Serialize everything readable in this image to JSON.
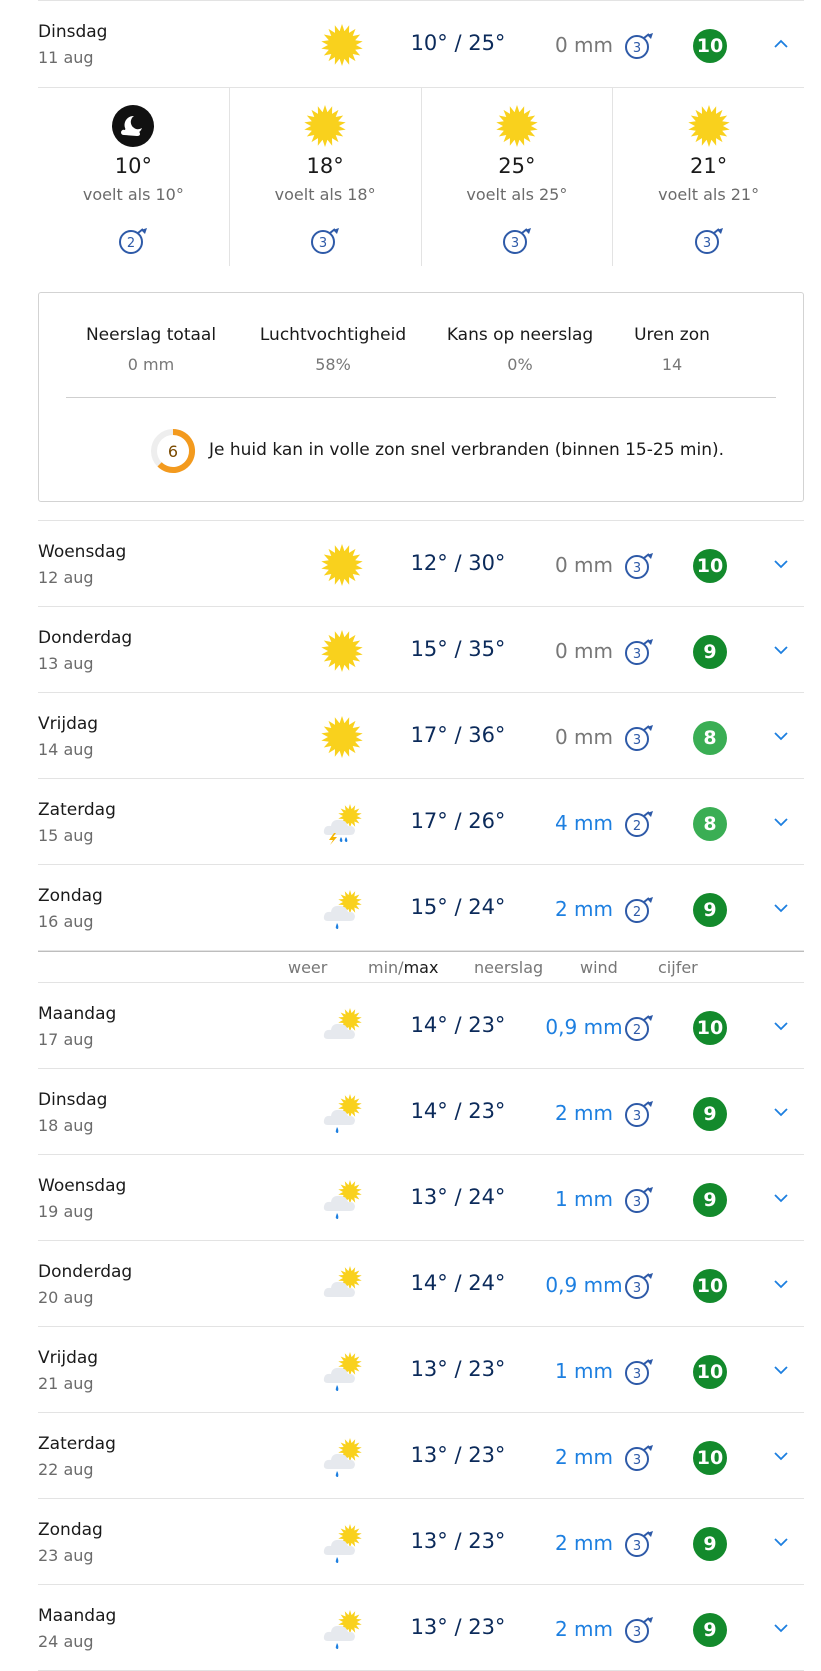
{
  "expanded_day": {
    "name": "Dinsdag",
    "date": "11 aug",
    "icon": "sun-icon",
    "temps": "10° / 25°",
    "precip": "0 mm",
    "wind": "3",
    "score": "10",
    "parts": [
      {
        "icon": "moon-cloud-icon",
        "temp": "10°",
        "feels": "voelt als 10°",
        "wind": "2"
      },
      {
        "icon": "sun-icon",
        "temp": "18°",
        "feels": "voelt als 18°",
        "wind": "3"
      },
      {
        "icon": "sun-icon",
        "temp": "25°",
        "feels": "voelt als 25°",
        "wind": "3"
      },
      {
        "icon": "sun-icon",
        "temp": "21°",
        "feels": "voelt als 21°",
        "wind": "3"
      }
    ],
    "stats": [
      {
        "label": "Neerslag totaal",
        "value": "0 mm"
      },
      {
        "label": "Luchtvochtigheid",
        "value": "58%"
      },
      {
        "label": "Kans op neerslag",
        "value": "0%"
      },
      {
        "label": "Uren zon",
        "value": "14"
      }
    ],
    "uv_index": "6",
    "uv_text": "Je huid kan in volle zon snel verbranden (binnen 15-25 min)."
  },
  "days_a": [
    {
      "name": "Woensdag",
      "date": "12 aug",
      "icon": "sun-icon",
      "temps": "12° / 30°",
      "precip": "0 mm",
      "wind": "3",
      "score": "10"
    },
    {
      "name": "Donderdag",
      "date": "13 aug",
      "icon": "sun-icon",
      "temps": "15° / 35°",
      "precip": "0 mm",
      "wind": "3",
      "score": "9"
    },
    {
      "name": "Vrijdag",
      "date": "14 aug",
      "icon": "sun-icon",
      "temps": "17° / 36°",
      "precip": "0 mm",
      "wind": "3",
      "score": "8"
    },
    {
      "name": "Zaterdag",
      "date": "15 aug",
      "icon": "thunder-rain-sun-icon",
      "temps": "17° / 26°",
      "precip": "4 mm",
      "wind": "2",
      "score": "8"
    },
    {
      "name": "Zondag",
      "date": "16 aug",
      "icon": "rain-sun-cloud-icon",
      "temps": "15° / 24°",
      "precip": "2 mm",
      "wind": "2",
      "score": "9"
    }
  ],
  "legend": {
    "weer": "weer",
    "min": "min/",
    "max": "max",
    "neerslag": "neerslag",
    "wind": "wind",
    "cijfer": "cijfer"
  },
  "days_b": [
    {
      "name": "Maandag",
      "date": "17 aug",
      "icon": "sun-cloud-icon",
      "temps": "14° / 23°",
      "precip": "0,9 mm",
      "wind": "2",
      "score": "10"
    },
    {
      "name": "Dinsdag",
      "date": "18 aug",
      "icon": "rain-sun-cloud-icon",
      "temps": "14° / 23°",
      "precip": "2 mm",
      "wind": "3",
      "score": "9"
    },
    {
      "name": "Woensdag",
      "date": "19 aug",
      "icon": "rain-sun-cloud-icon",
      "temps": "13° / 24°",
      "precip": "1 mm",
      "wind": "3",
      "score": "9"
    },
    {
      "name": "Donderdag",
      "date": "20 aug",
      "icon": "sun-cloud-icon",
      "temps": "14° / 24°",
      "precip": "0,9 mm",
      "wind": "3",
      "score": "10"
    },
    {
      "name": "Vrijdag",
      "date": "21 aug",
      "icon": "rain-sun-cloud-icon",
      "temps": "13° / 23°",
      "precip": "1 mm",
      "wind": "3",
      "score": "10"
    },
    {
      "name": "Zaterdag",
      "date": "22 aug",
      "icon": "rain-sun-cloud-icon",
      "temps": "13° / 23°",
      "precip": "2 mm",
      "wind": "3",
      "score": "10"
    },
    {
      "name": "Zondag",
      "date": "23 aug",
      "icon": "rain-sun-cloud-icon",
      "temps": "13° / 23°",
      "precip": "2 mm",
      "wind": "3",
      "score": "9"
    },
    {
      "name": "Maandag",
      "date": "24 aug",
      "icon": "rain-sun-cloud-icon",
      "temps": "13° / 23°",
      "precip": "2 mm",
      "wind": "3",
      "score": "9"
    }
  ],
  "colors": {
    "temp": "#0b2a5a",
    "rain": "#1d7fe0",
    "score_dark": "#138a2c",
    "score_light": "#3aae54",
    "sun": "#f9d11d",
    "wind": "#2e5aa8",
    "uv": "#f39a1e"
  }
}
